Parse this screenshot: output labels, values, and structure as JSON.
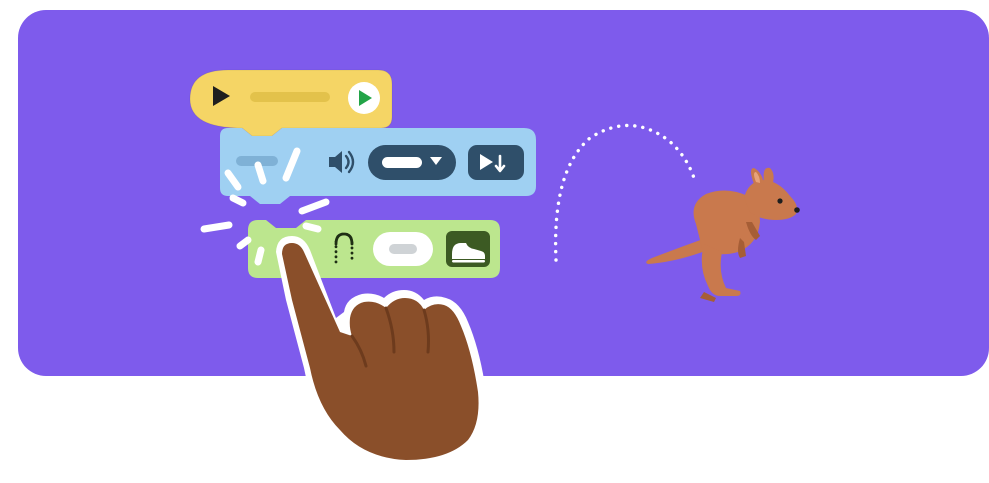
{
  "colors": {
    "panel": "#7e5bec",
    "event_block": "#f5d565",
    "event_block_dark": "#e3c24b",
    "sound_block": "#9fd0f2",
    "sound_pill": "#2f4f6a",
    "motion_block": "#bce68e",
    "motion_icon_bg": "#3c5a23",
    "kangaroo": "#c9794d",
    "hand": "#8a4f2a",
    "play_green": "#22a447"
  },
  "icons": {
    "event": [
      "play-icon",
      "green-flag-play-icon"
    ],
    "sound": [
      "speaker-icon",
      "dropdown-arrow-icon",
      "play-until-done-icon"
    ],
    "motion": [
      "hop-arc-icon",
      "shoe-icon"
    ],
    "scene": [
      "kangaroo-icon",
      "tap-hand-icon",
      "sparkle-icon"
    ]
  }
}
